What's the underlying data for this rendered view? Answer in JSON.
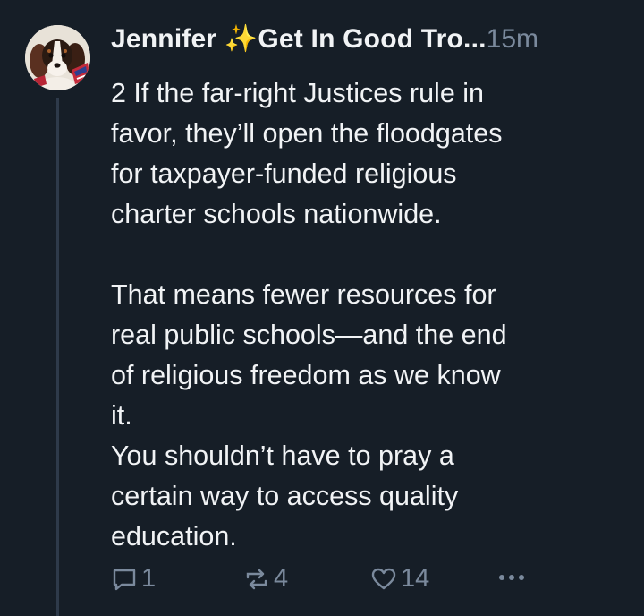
{
  "post": {
    "author": "Jennifer ✨Get In Good Tro...",
    "separator": " ",
    "time": "15m",
    "text": "2 If the far-right Justices rule in\nfavor, they’ll open the floodgates\nfor taxpayer-funded religious\ncharter schools nationwide.\n\nThat means fewer resources for\nreal public schools—and the end\nof religious freedom as we know\nit.\nYou shouldn’t have to pray a\ncertain way to access quality\neducation.",
    "counts": {
      "replies": "1",
      "reposts": "4",
      "likes": "14"
    }
  },
  "icons": {
    "reply": "reply-icon",
    "repost": "repost-icon",
    "like": "heart-icon",
    "more": "more-options-icon"
  },
  "colors": {
    "background": "#161e27",
    "text": "#f1f3f5",
    "muted": "#7b8a9d",
    "thread_line": "#2e3a4a"
  }
}
